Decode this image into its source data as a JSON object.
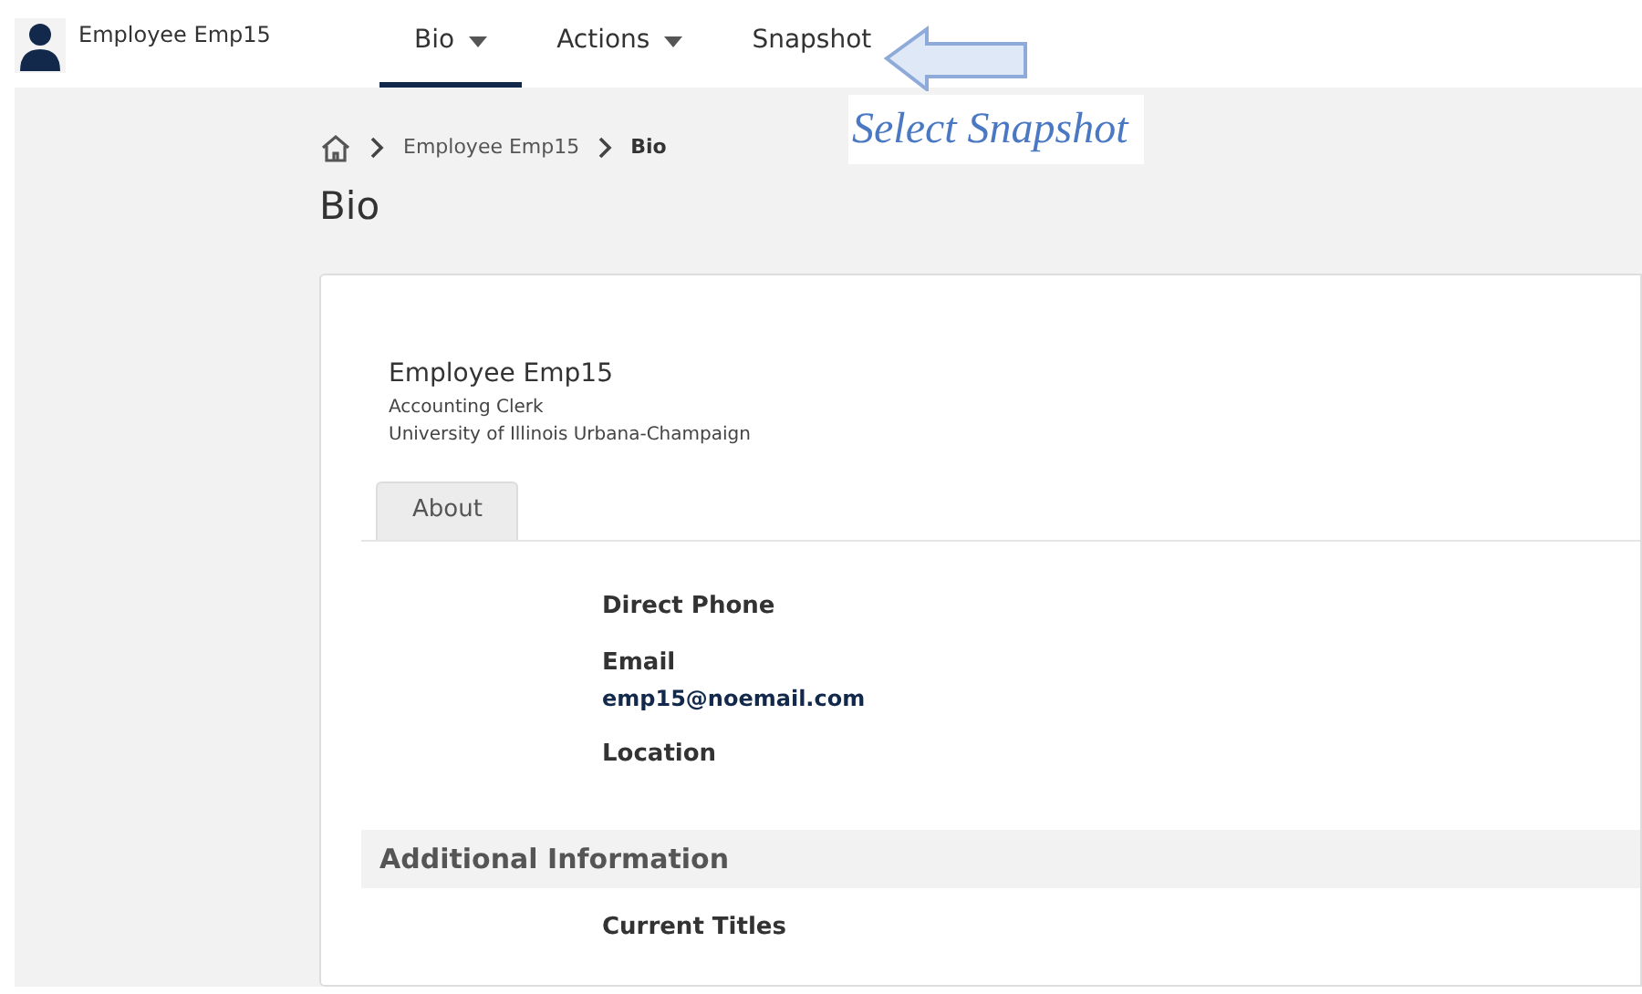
{
  "header": {
    "user_name": "Employee Emp15"
  },
  "nav": [
    {
      "label": "Bio",
      "selected": true,
      "has_menu": true
    },
    {
      "label": "Actions",
      "selected": false,
      "has_menu": true
    },
    {
      "label": "Snapshot",
      "selected": false,
      "has_menu": false
    }
  ],
  "callout": {
    "text": "Select Snapshot"
  },
  "breadcrumb": [
    "Employee Emp15",
    "Bio"
  ],
  "page_title": "Bio",
  "profile": {
    "name": "Employee Emp15",
    "title": "Accounting Clerk",
    "organization": "University of Illinois Urbana-Champaign"
  },
  "tabs": [
    {
      "label": "About",
      "selected": true
    }
  ],
  "fields": [
    {
      "label": "Direct Phone"
    },
    {
      "label": "Email",
      "value": "emp15@noemail.com"
    },
    {
      "label": "Location"
    }
  ],
  "sections": [
    {
      "title": "Additional Information",
      "fields": [
        {
          "label": "Current Titles"
        }
      ]
    }
  ]
}
